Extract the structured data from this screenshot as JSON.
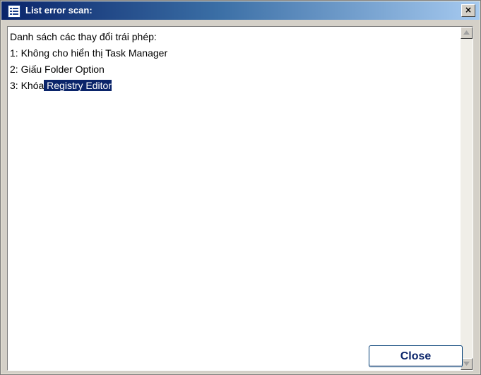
{
  "window": {
    "title": "List error scan:",
    "title_icon": "list-window-icon",
    "close_glyph": "×"
  },
  "textarea": {
    "lines": [
      "Danh sách các thay đổi trái phép:",
      "1: Không cho hiển thị Task Manager",
      "2: Giấu Folder Option"
    ],
    "last_line_prefix": "3: Khóa",
    "last_line_selected": " Registry Editor"
  },
  "buttons": {
    "close_label": "Close"
  },
  "colors": {
    "selection": "#0a246a",
    "title_bar_start": "#0a246a",
    "title_bar_end": "#a6caf0"
  }
}
